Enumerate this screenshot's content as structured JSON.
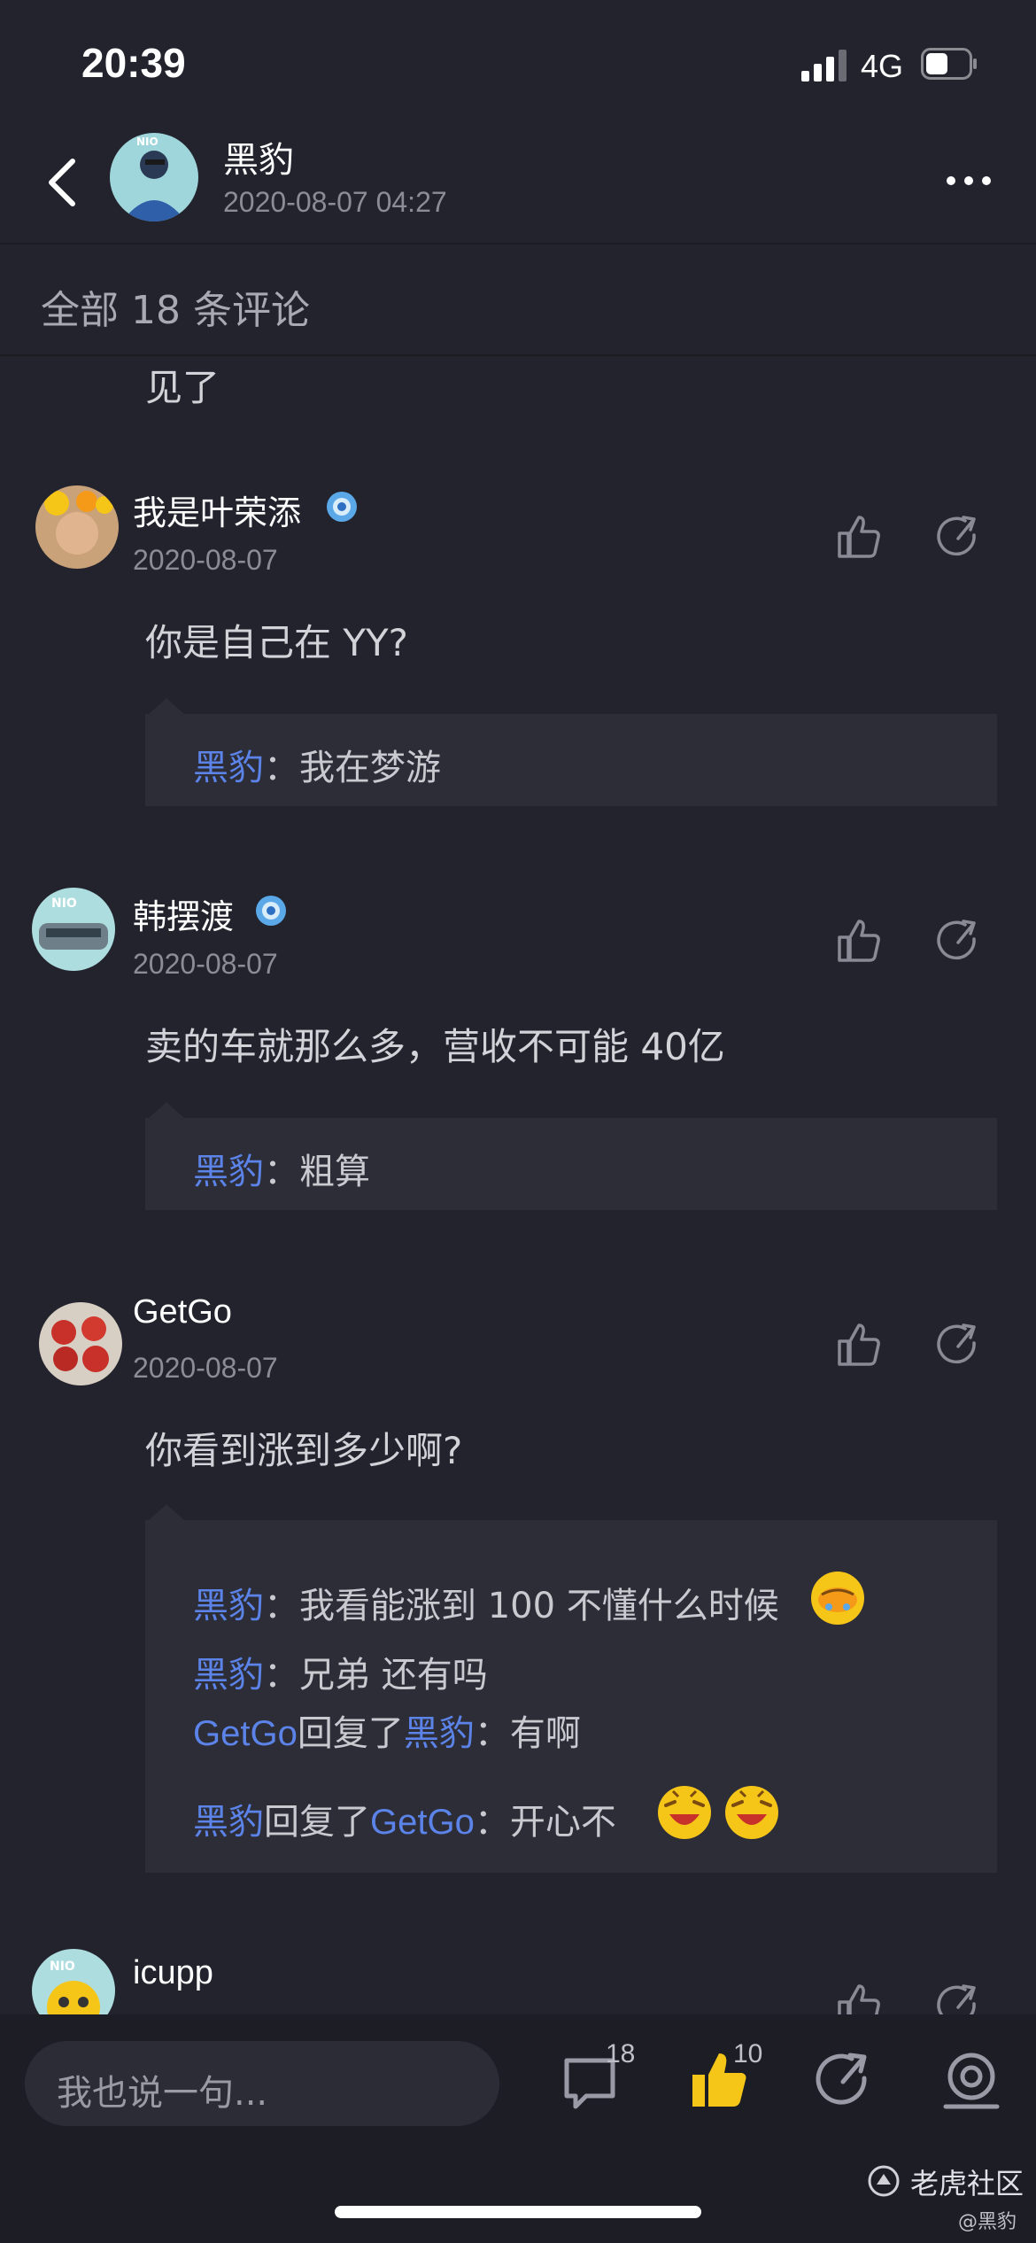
{
  "status_bar": {
    "time": "20:39",
    "network": "4G"
  },
  "header": {
    "author": "黑豹",
    "timestamp": "2020-08-07 04:27"
  },
  "comments_header": {
    "label": "全部 18 条评论"
  },
  "partial_comment": {
    "text": "见了"
  },
  "comments": [
    {
      "name": "我是叶荣添",
      "date": "2020-08-07",
      "text": "你是自己在 YY?",
      "replies": [
        {
          "user": "黑豹",
          "sep": "：",
          "text": "我在梦游"
        }
      ]
    },
    {
      "name": "韩摆渡",
      "date": "2020-08-07",
      "text": "卖的车就那么多，营收不可能 40亿",
      "replies": [
        {
          "user": "黑豹",
          "sep": "：",
          "text": "粗算"
        }
      ]
    },
    {
      "name": "GetGo",
      "date": "2020-08-07",
      "text": "你看到涨到多少啊?",
      "replies": [
        {
          "user": "黑豹",
          "sep": "：",
          "text": "我看能涨到 100 不懂什么时候"
        },
        {
          "user": "黑豹",
          "sep": "：",
          "text": "兄弟 还有吗"
        },
        {
          "user": "GetGo",
          "mid": "回复了",
          "target": "黑豹",
          "sep": "：",
          "text": "有啊"
        },
        {
          "user": "黑豹",
          "mid": "回复了",
          "target": "GetGo",
          "sep": "：",
          "text": "开心不"
        }
      ]
    },
    {
      "name": "icupp"
    }
  ],
  "bottom_bar": {
    "input_placeholder": "我也说一句...",
    "comment_count": "18",
    "like_count": "10"
  },
  "watermark": {
    "brand": "老虎社区",
    "handle": "@黑豹"
  },
  "colors": {
    "background": "#23232d",
    "reply_bg": "#2d2d38",
    "link_blue": "#5b83e8",
    "like_yellow": "#f5c518"
  }
}
